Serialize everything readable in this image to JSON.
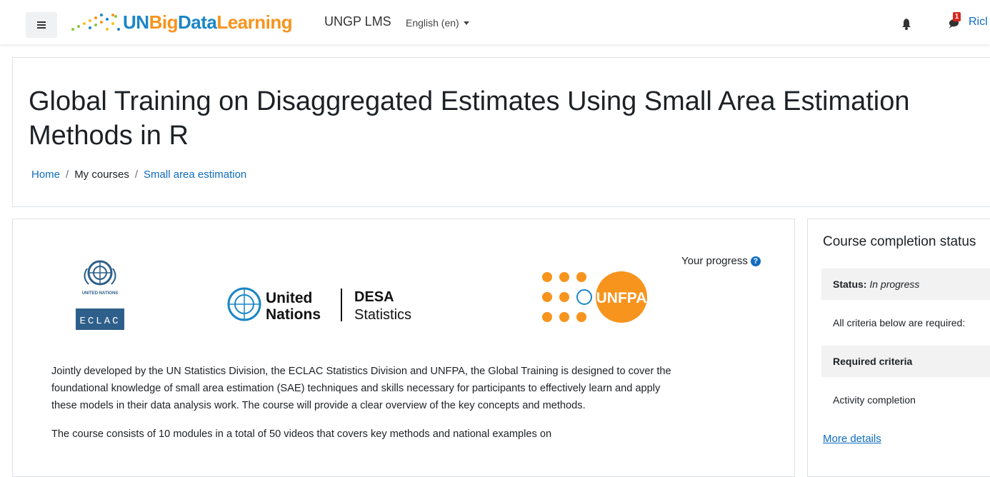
{
  "navbar": {
    "menu_icon": "hamburger-icon",
    "brand_un": "UN",
    "brand_big": "Big",
    "brand_data": "Data",
    "brand_learning": "Learning",
    "site_name": "UNGP LMS",
    "language": "English (en)",
    "notification_icon": "bell-icon",
    "message_icon": "message-icon",
    "message_count": "1",
    "user_name": "Ricl"
  },
  "page": {
    "title": "Global Training on Disaggregated Estimates Using Small Area Estimation Methods in R",
    "breadcrumb": [
      "Home",
      "My courses",
      "Small area estimation"
    ],
    "breadcrumb_sep": "/"
  },
  "course": {
    "progress_label": "Your progress",
    "logos": {
      "eclac_top": "UNITED NATIONS",
      "eclac_name": "ECLAC",
      "un_line1": "United",
      "un_line2": "Nations",
      "desa_line1": "DESA",
      "desa_line2": "Statistics",
      "unfpa": "UNFPA"
    },
    "paragraphs": [
      "Jointly developed by the UN Statistics Division, the ECLAC Statistics Division and UNFPA, the Global Training is designed to cover the foundational knowledge of small area estimation (SAE) techniques and skills necessary for participants to effectively learn and apply these models in their data analysis work. The course will provide a clear overview of the key concepts and methods.",
      "The course consists of 10 modules in a total of 50 videos that covers key methods and national examples on"
    ]
  },
  "completion": {
    "title": "Course completion status",
    "status_label": "Status:",
    "status_value": "In progress",
    "criteria_note": "All criteria below are required:",
    "required_header": "Required criteria",
    "criterion": "Activity completion",
    "more_details": "More details"
  },
  "colors": {
    "brand_blue": "#0f6cbf",
    "un_blue": "#1a86c7",
    "unfpa_orange": "#f7941d",
    "badge_red": "#d9261c"
  }
}
